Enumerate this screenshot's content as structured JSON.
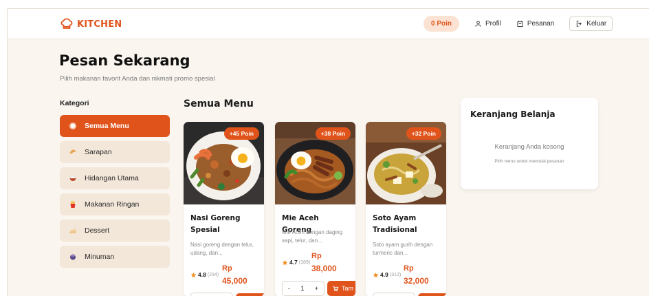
{
  "brand": {
    "name": "KITCHEN",
    "color": "#e0541c"
  },
  "nav": {
    "points": "0 Poin",
    "profile": "Profil",
    "orders": "Pesanan",
    "logout": "Keluar"
  },
  "page": {
    "title": "Pesan Sekarang",
    "subtitle": "Pilih makanan favorit Anda dan nikmati promo spesial"
  },
  "categories": {
    "title": "Kategori",
    "items": [
      {
        "label": "Semua Menu",
        "icon": "plate-icon",
        "active": true
      },
      {
        "label": "Sarapan",
        "icon": "croissant-icon",
        "active": false
      },
      {
        "label": "Hidangan Utama",
        "icon": "rice-bowl-icon",
        "active": false
      },
      {
        "label": "Makanan Ringan",
        "icon": "fries-icon",
        "active": false
      },
      {
        "label": "Dessert",
        "icon": "cake-icon",
        "active": false
      },
      {
        "label": "Minuman",
        "icon": "drink-icon",
        "active": false
      }
    ]
  },
  "menu": {
    "title": "Semua Menu",
    "items": [
      {
        "name": "Nasi Goreng Spesial",
        "points": "+45 Poin",
        "desc": "Nasi goreng dengan telur, udang, dan...",
        "rating": "4.8",
        "reviews": "(234)",
        "currency": "Rp",
        "price": "45,000"
      },
      {
        "name": "Mie Aceh Goreng",
        "points": "+38 Poin",
        "desc": "Mie Aceh dengan daging sapi, telur, dan...",
        "rating": "4.7",
        "reviews": "(189)",
        "currency": "Rp",
        "price": "38,000",
        "qty": "1",
        "minus": "-",
        "plus": "+",
        "add_label": "Tam"
      },
      {
        "name": "Soto Ayam Tradisional",
        "points": "+32 Poin",
        "desc": "Soto ayam gurih dengan turmeric dan...",
        "rating": "4.9",
        "reviews": "(312)",
        "currency": "Rp",
        "price": "32,000"
      }
    ]
  },
  "cart": {
    "title": "Keranjang Belanja",
    "empty": "Keranjang Anda kosong",
    "hint": "Pilih menu untuk memulai pesanan"
  }
}
